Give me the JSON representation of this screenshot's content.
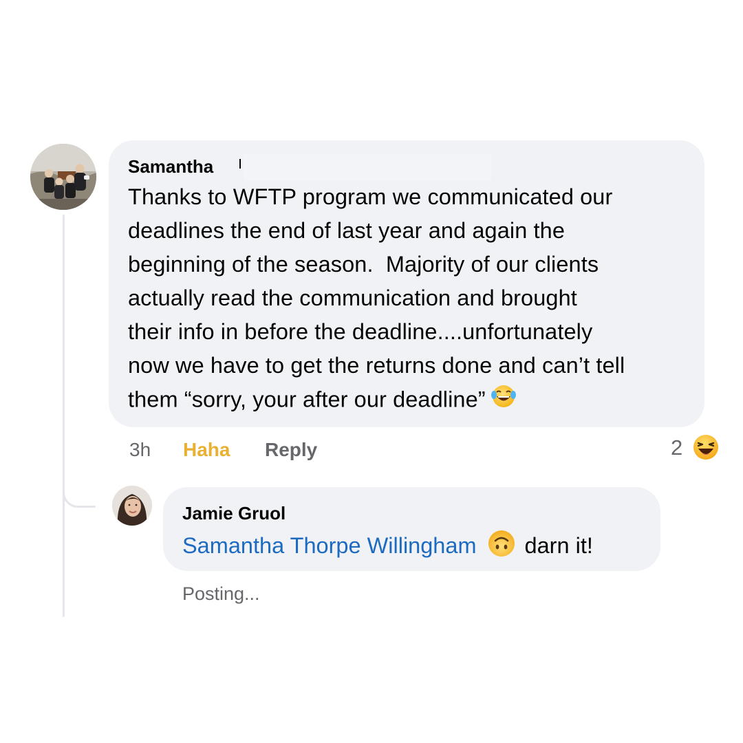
{
  "comment": {
    "author": "Samantha",
    "text": "Thanks to WFTP program we communicated our\ndeadlines the end of last year and again the\nbeginning of the season.  Majority of our clients\nactually read the communication and brought\ntheir info in before the deadline....unfortunately\nnow we have to get the returns done and can’t tell\nthem “sorry, your after our deadline”",
    "trailing_emoji": "face-with-tears-of-joy-icon",
    "time": "3h",
    "reaction_label": "Haha",
    "reply_label": "Reply",
    "reaction_count": "2",
    "reaction_icon": "haha-reaction-icon"
  },
  "reply": {
    "author": "Jamie Gruol",
    "mention": "Samantha Thorpe Willingham",
    "emoji": "upside-down-face-icon",
    "text": "darn it!",
    "status": "Posting..."
  },
  "colors": {
    "bubble": "#f0f2f5",
    "mention": "#1d6ac1",
    "haha": "#e9b134",
    "meta": "#65676b",
    "thread_line": "#e4e6eb"
  }
}
